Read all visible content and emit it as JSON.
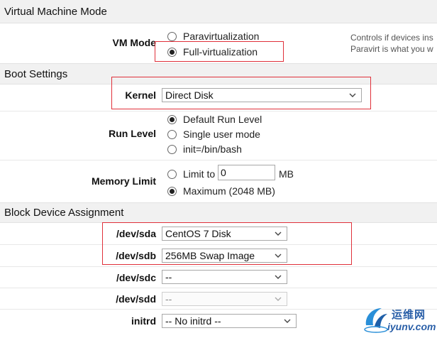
{
  "sections": {
    "vm_mode": "Virtual Machine Mode",
    "boot": "Boot Settings",
    "block": "Block Device Assignment"
  },
  "vm_mode": {
    "label": "VM Mode",
    "options": [
      "Paravirtualization",
      "Full-virtualization"
    ],
    "selected": "Full-virtualization",
    "help_line1": "Controls if devices ins",
    "help_line2": "Paravirt is what you w"
  },
  "kernel": {
    "label": "Kernel",
    "value": "Direct Disk"
  },
  "run_level": {
    "label": "Run Level",
    "options": [
      "Default Run Level",
      "Single user mode",
      "init=/bin/bash"
    ],
    "selected": "Default Run Level"
  },
  "memory_limit": {
    "label": "Memory Limit",
    "limit_label": "Limit to",
    "limit_value": "0",
    "unit": "MB",
    "max_label": "Maximum (2048 MB)",
    "selected": "Maximum (2048 MB)"
  },
  "devices": [
    {
      "label": "/dev/sda",
      "value": "CentOS 7 Disk",
      "disabled": false
    },
    {
      "label": "/dev/sdb",
      "value": "256MB Swap Image",
      "disabled": false
    },
    {
      "label": "/dev/sdc",
      "value": "--",
      "disabled": false
    },
    {
      "label": "/dev/sdd",
      "value": "--",
      "disabled": true
    }
  ],
  "initrd": {
    "label": "initrd",
    "value": "-- No initrd --"
  },
  "watermark": {
    "chinese": "运维网",
    "domain": "iyunv.com"
  },
  "colors": {
    "highlight_box": "#e0303a",
    "section_bg": "#f1f1f1",
    "watermark": "#2a5fa8"
  }
}
